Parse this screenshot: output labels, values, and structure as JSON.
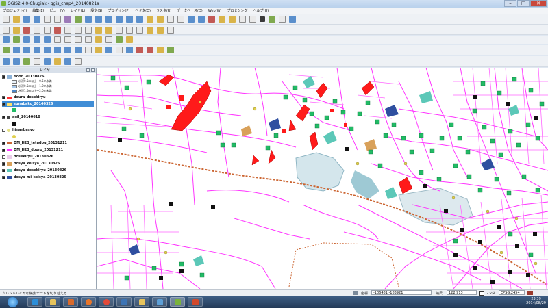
{
  "window": {
    "title": "QGIS2.4.0-Chugiak - qgis_chap4_20140821a",
    "minimize": "–",
    "maximize": "□",
    "close": "✕"
  },
  "menu": [
    "プロジェクト(J)",
    "編集(E)",
    "ビュー(V)",
    "レイヤ(L)",
    "設定(S)",
    "プラグイン(P)",
    "ベクタ(O)",
    "ラスタ(R)",
    "データベース(D)",
    "Web(W)",
    "プロセシング",
    "ヘルプ(H)"
  ],
  "layers_panel": {
    "title": "レイヤ",
    "layers": [
      {
        "name": "flood_20130826",
        "checked": true,
        "selected": false,
        "symbol": "group"
      },
      {
        "name": "doura_dosekiryu",
        "checked": true,
        "selected": false,
        "symbol": "fill"
      },
      {
        "name": "sunabako_20140326",
        "checked": true,
        "selected": true,
        "symbol": "point"
      },
      {
        "name": "anil_20140618",
        "checked": true,
        "selected": false,
        "symbol": "point"
      },
      {
        "name": "hinanbasyo",
        "checked": false,
        "selected": false,
        "symbol": "point"
      },
      {
        "name": "DM_H23_tetudou_20131211",
        "checked": true,
        "selected": false,
        "symbol": "line"
      },
      {
        "name": "DM_H23_douro_20131211",
        "checked": true,
        "selected": false,
        "symbol": "line"
      },
      {
        "name": "dosekiryu_20130826",
        "checked": false,
        "selected": false,
        "symbol": "fill"
      },
      {
        "name": "dosya_keisya_20130826",
        "checked": true,
        "selected": false,
        "symbol": "fill"
      },
      {
        "name": "dosya_dosekiryu_20130826",
        "checked": true,
        "selected": false,
        "symbol": "fill"
      },
      {
        "name": "dosya_mi_keisya_20130826",
        "checked": true,
        "selected": false,
        "symbol": "fill"
      }
    ],
    "flood_legend": [
      "水深0.5m以上～0.5m未満",
      "水深0.5m以上～1.0m未満",
      "水深1.0m以上～2.0m未満"
    ]
  },
  "statusbar": {
    "message": "カレントレイヤの編集モードを切り替える",
    "coord_label": "座標",
    "coord_value": "-106481,-183921",
    "scale_label": "縮尺",
    "scale_value": "122,913",
    "render_label": "レンダ",
    "crs": "EPSG:2454"
  },
  "taskbar": {
    "time": "23:39",
    "date": "2014/08/29"
  },
  "colors": {
    "road": "#ff33ff",
    "sediment": "#ff0000",
    "shelter": "#22bb66",
    "water": "#9ec9d4",
    "rail": "#cc6633"
  }
}
